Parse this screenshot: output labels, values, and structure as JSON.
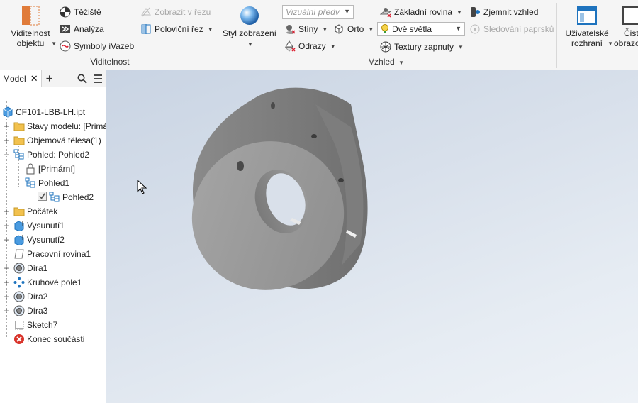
{
  "ribbon": {
    "visibility": {
      "object_visibility_label_1": "Viditelnost",
      "object_visibility_label_2": "objektu",
      "center_of_gravity": "Těžiště",
      "analysis": "Analýza",
      "ivazeb_symbols": "Symboly iVazeb",
      "show_in_section": "Zobrazit v řezu",
      "half_section": "Poloviční řez",
      "panel_label": "Viditelnost"
    },
    "appearance": {
      "display_style_label": "Styl zobrazení",
      "visual_style_combo": "Vizuální předv",
      "shadows": "Stíny",
      "ortho": "Orto",
      "reflections": "Odrazy",
      "ground_plane": "Základní rovina",
      "two_lights_combo": "Dvě světla",
      "textures_on": "Textury zapnuty",
      "smooth_appearance": "Zjemnit vzhled",
      "ray_tracing": "Sledování paprsků",
      "panel_label": "Vzhled"
    },
    "windows": {
      "user_interface_1": "Uživatelské",
      "user_interface_2": "rozhraní",
      "clean_screen_1": "Čist",
      "clean_screen_2": "obrazo"
    }
  },
  "browser": {
    "tab_label": "Model",
    "tree": [
      {
        "label": "CF101-LBB-LH.ipt",
        "icon": "part-icon",
        "expander": ""
      },
      {
        "label": "Stavy modelu: [Primárn",
        "icon": "folder-icon",
        "expander": "+"
      },
      {
        "label": "Objemová tělesa(1)",
        "icon": "folder-icon",
        "expander": "+"
      },
      {
        "label": "Pohled: Pohled2",
        "icon": "view-icon",
        "expander": "−"
      },
      {
        "label": "[Primární]",
        "icon": "lock-icon",
        "expander": ""
      },
      {
        "label": "Pohled1",
        "icon": "view-icon",
        "expander": ""
      },
      {
        "label": "Pohled2",
        "icon": "view-checked-icon",
        "expander": ""
      },
      {
        "label": "Počátek",
        "icon": "folder-icon",
        "expander": "+"
      },
      {
        "label": "Vysunutí1",
        "icon": "extrude-icon",
        "expander": "+"
      },
      {
        "label": "Vysunutí2",
        "icon": "extrude-icon",
        "expander": "+"
      },
      {
        "label": "Pracovní rovina1",
        "icon": "work-plane-icon",
        "expander": ""
      },
      {
        "label": "Díra1",
        "icon": "hole-icon",
        "expander": "+"
      },
      {
        "label": "Kruhové pole1",
        "icon": "circular-pattern-icon",
        "expander": "+"
      },
      {
        "label": "Díra2",
        "icon": "hole-icon",
        "expander": "+"
      },
      {
        "label": "Díra3",
        "icon": "hole-icon",
        "expander": "+"
      },
      {
        "label": "Sketch7",
        "icon": "sketch-icon",
        "expander": ""
      },
      {
        "label": "Konec součásti",
        "icon": "end-of-part-icon",
        "expander": ""
      }
    ]
  },
  "colors": {
    "accent": "#1e73be",
    "folder": "#f2c14e",
    "error": "#d9342b"
  }
}
